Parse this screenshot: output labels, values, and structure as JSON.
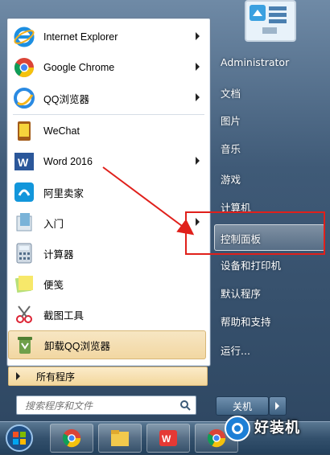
{
  "pinned": [
    {
      "label": "Internet Explorer",
      "icon": "internet-explorer-icon",
      "arrow": true
    },
    {
      "label": "Google Chrome",
      "icon": "chrome-icon",
      "arrow": true
    },
    {
      "label": "QQ浏览器",
      "icon": "qq-browser-icon",
      "arrow": true
    }
  ],
  "recent": [
    {
      "label": "WeChat",
      "icon": "wechat-icon",
      "arrow": false
    },
    {
      "label": "Word 2016",
      "icon": "word-icon",
      "arrow": true
    },
    {
      "label": "阿里卖家",
      "icon": "ali-seller-icon",
      "arrow": false
    },
    {
      "label": "入门",
      "icon": "getting-started-icon",
      "arrow": true
    },
    {
      "label": "计算器",
      "icon": "calculator-icon",
      "arrow": false
    },
    {
      "label": "便笺",
      "icon": "sticky-notes-icon",
      "arrow": false
    },
    {
      "label": "截图工具",
      "icon": "snipping-tool-icon",
      "arrow": false
    },
    {
      "label": "卸载QQ浏览器",
      "icon": "uninstall-icon",
      "arrow": false,
      "highlighted": true
    }
  ],
  "all_programs": "所有程序",
  "search": {
    "placeholder": "搜索程序和文件"
  },
  "right_links": [
    "Administrator",
    "文档",
    "图片",
    "音乐",
    "游戏",
    "计算机",
    "控制面板",
    "设备和打印机",
    "默认程序",
    "帮助和支持",
    "运行..."
  ],
  "shutdown_label": "关机",
  "watermark": "好装机",
  "colors": {
    "highlight": "#f2d7a2",
    "annotation_red": "#e0201b"
  }
}
